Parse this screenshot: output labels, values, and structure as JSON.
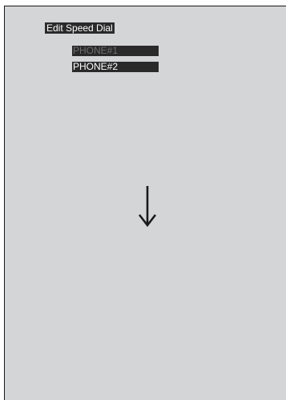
{
  "screen": {
    "title": "Edit Speed Dial",
    "phones": [
      {
        "label": "PHONE#1",
        "state": "dim"
      },
      {
        "label": "PHONE#2",
        "state": "active"
      }
    ]
  },
  "icons": {
    "arrow": "arrow-down-icon"
  },
  "colors": {
    "screen_bg": "#d4d5d7",
    "item_bg": "#2a2a2a",
    "text_active": "#ffffff",
    "text_dim": "#6f6f6f"
  }
}
